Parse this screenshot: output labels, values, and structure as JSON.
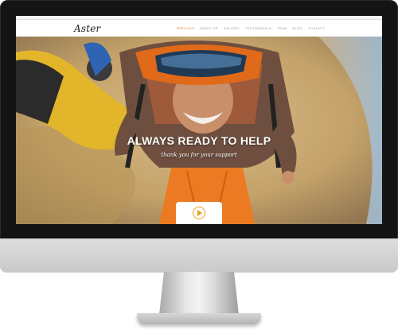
{
  "site": {
    "logo": "Aster",
    "nav": [
      "SERVICES",
      "ABOUT US",
      "GALLERY",
      "TESTIMONIALS",
      "TEAM",
      "BLOG",
      "CONTACT"
    ]
  },
  "hero": {
    "title": "ALWAYS READY TO HELP",
    "subtitle": "thank you for your support"
  },
  "icons": {
    "play": "play-icon"
  },
  "colors": {
    "accent": "#e67e22",
    "play": "#e8a019",
    "sky": "#8fb4d6",
    "ground": "#c9a872"
  }
}
